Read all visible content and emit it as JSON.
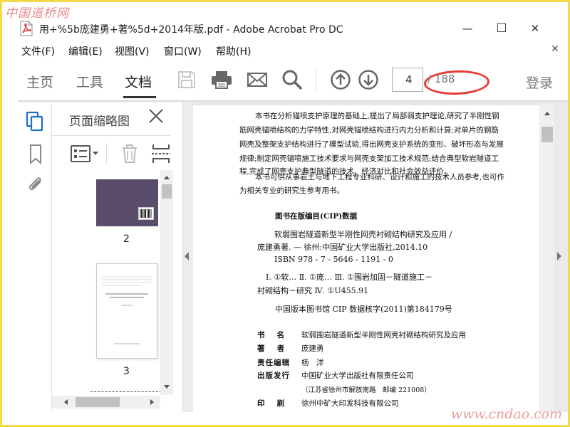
{
  "watermarks": {
    "top": "中国道桥网",
    "bottom": "www.cndao.com"
  },
  "window": {
    "title": "用+%5b庞建勇+著%5d+2014年版.pdf - Adobe Acrobat Pro DC",
    "minimize": "—",
    "maximize": "☐",
    "close": "✕"
  },
  "menu": {
    "items": [
      "文件(F)",
      "编辑(E)",
      "视图(V)",
      "窗口(W)",
      "帮助(H)"
    ],
    "close": "✕"
  },
  "toolbar": {
    "tabs": [
      "主页",
      "工具",
      "文档"
    ],
    "active_tab": "文档",
    "page_current": "4",
    "page_total": "/ 188",
    "login": "登录",
    "icons": [
      "save-icon",
      "print-icon",
      "email-icon",
      "search-icon",
      "page-up-icon",
      "page-down-icon"
    ]
  },
  "panel": {
    "title": "页面缩略图",
    "close": "✕",
    "thumbs": [
      {
        "label": "2"
      },
      {
        "label": "3"
      }
    ]
  },
  "document": {
    "intro": [
      "本书在分析锚喷支护原理的基础上,提出了局部弱支护理论,研究了半刚性钢",
      "筋网壳锚喷结构的力学特性,对网壳锚喷结构进行内力分析和计算;对单片的钢筋",
      "网壳及整架支护结构进行了模型试验,得出网壳支护系统的变形、破坏形态与发展",
      "规律;制定网壳锚喷施工技术要求与网壳支架加工技术规范;结合典型软岩隧道工",
      "程,完成了网壳支护典型隧道的技术、经济对比和社会效益评价。",
      "本书可供从事岩土与地下工程专业科研、设计和施工的技术人员参考,也可作",
      "为相关专业的研究生参考用书。"
    ],
    "cip_title": "图书在版编目(CIP)数据",
    "cip_lines": [
      "软弱围岩隧道新型半刚性网壳衬砌结构研究及应用 /",
      "庞建勇著. — 徐州:中国矿业大学出版社,2014.10",
      "ISBN 978 - 7 - 5646 - 1191 - 0",
      "Ⅰ. ①软… Ⅱ. ①庞… Ⅲ. ①围岩加固－隧道施工－",
      "衬砌结构－研究 Ⅳ. ①U455.91"
    ],
    "cip_note": "中国版本图书馆 CIP 数据核字(2011)第184179号",
    "meta": [
      {
        "key": "书　 名",
        "value": "软弱围岩隧道新型半刚性网壳衬砌结构研究及应用"
      },
      {
        "key": "著　 者",
        "value": "庞建勇"
      },
      {
        "key": "责任编辑",
        "value": "杨　洋"
      },
      {
        "key": "出版发行",
        "value": "中国矿业大学出版社有限责任公司"
      },
      {
        "key": "",
        "value": "（江苏省徐州市解放南路　邮编 221008）"
      },
      {
        "key": "印　 刷",
        "value": "徐州中矿大印发科技有限公司"
      }
    ]
  },
  "colors": {
    "frame": "#f3d94a",
    "annotation": "#e53b35",
    "cover": "#5a4d6c",
    "watermark": "#e88b8b"
  }
}
